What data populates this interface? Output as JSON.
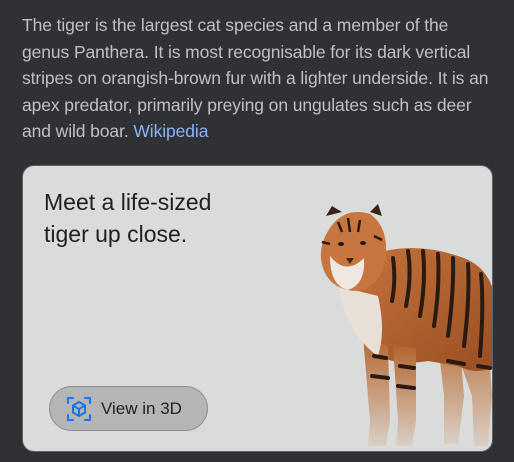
{
  "description": {
    "text": "The tiger is the largest cat species and a member of the genus Panthera. It is most recognisable for its dark vertical stripes on orangish-brown fur with a lighter underside. It is an apex predator, primarily preying on ungulates such as deer and wild boar.",
    "source_link": "Wikipedia"
  },
  "card": {
    "title": "Meet a life-sized tiger up close.",
    "button_label": "View in 3D",
    "button_icon": "cube-3d-icon",
    "image": "tiger-3d-model",
    "background_color": "#dadcdb"
  },
  "colors": {
    "page_background": "#303134",
    "body_text": "#bdc1c6",
    "link": "#8ab4f8",
    "icon_accent": "#1a73e8"
  }
}
